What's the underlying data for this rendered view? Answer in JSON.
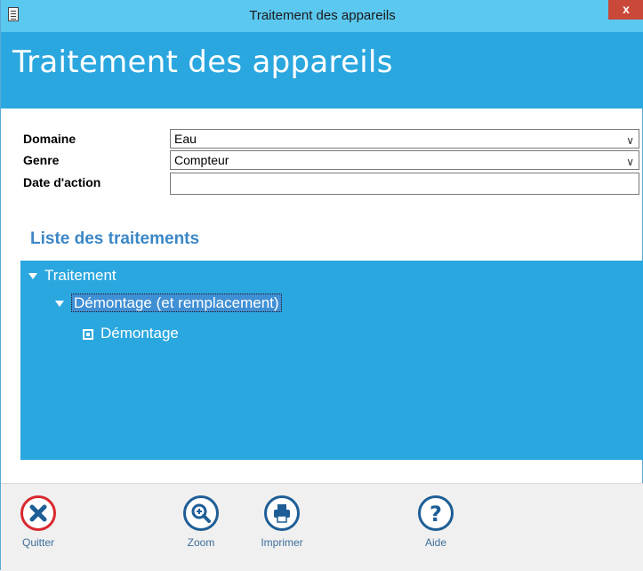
{
  "window": {
    "title": "Traitement des appareils",
    "close_label": "x"
  },
  "header": {
    "title": "Traitement des appareils"
  },
  "form": {
    "domaine": {
      "label": "Domaine",
      "value": "Eau"
    },
    "genre": {
      "label": "Genre",
      "value": "Compteur"
    },
    "date_action": {
      "label": "Date d'action",
      "value": ""
    }
  },
  "section": {
    "title": "Liste des traitements"
  },
  "tree": {
    "root": "Traitement",
    "child": "Démontage (et remplacement)",
    "leaf": "Démontage"
  },
  "footer": {
    "quitter": "Quitter",
    "zoom": "Zoom",
    "imprimer": "Imprimer",
    "aide": "Aide"
  },
  "colors": {
    "accent": "#2ba7df",
    "titlebar": "#5bc8ef",
    "close": "#c9483a",
    "danger": "#d9282f",
    "icon": "#1e5e96"
  }
}
